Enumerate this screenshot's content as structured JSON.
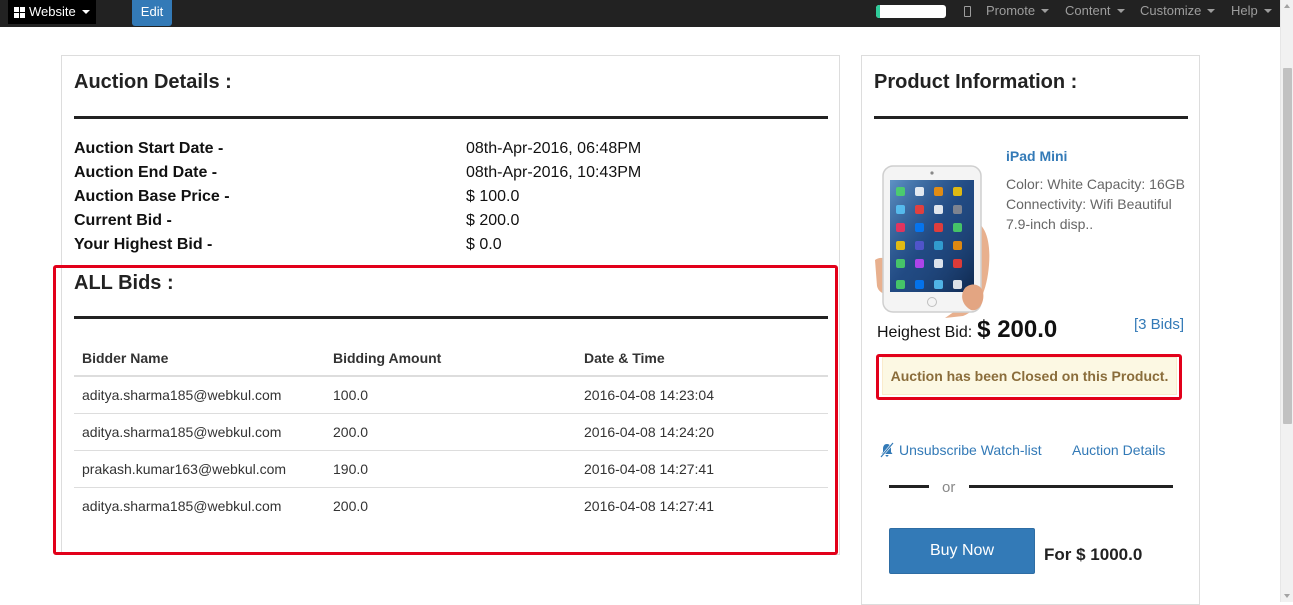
{
  "navbar": {
    "website_label": "Website",
    "edit_label": "Edit",
    "progress_fraction": 0.05,
    "menus": [
      {
        "label": "Promote"
      },
      {
        "label": "Content"
      },
      {
        "label": "Customize"
      },
      {
        "label": "Help"
      }
    ]
  },
  "auction_details": {
    "title": "Auction Details :",
    "rows": [
      {
        "label": "Auction Start Date -",
        "value": "08th-Apr-2016, 06:48PM"
      },
      {
        "label": "Auction End Date -",
        "value": "08th-Apr-2016, 10:43PM"
      },
      {
        "label": "Auction Base Price -",
        "value": "$ 100.0"
      },
      {
        "label": "Current Bid -",
        "value": "$ 200.0"
      },
      {
        "label": "Your Highest Bid -",
        "value": "$ 0.0"
      }
    ]
  },
  "all_bids": {
    "title": "ALL Bids :",
    "columns": [
      "Bidder Name",
      "Bidding Amount",
      "Date & Time"
    ],
    "rows": [
      [
        "aditya.sharma185@webkul.com",
        "100.0",
        "2016-04-08 14:23:04"
      ],
      [
        "aditya.sharma185@webkul.com",
        "200.0",
        "2016-04-08 14:24:20"
      ],
      [
        "prakash.kumar163@webkul.com",
        "190.0",
        "2016-04-08 14:27:41"
      ],
      [
        "aditya.sharma185@webkul.com",
        "200.0",
        "2016-04-08 14:27:41"
      ]
    ]
  },
  "product_info": {
    "title": "Product Information :",
    "name": "iPad Mini",
    "description": "Color: White Capacity: 16GB Connectivity: Wifi Beautiful 7.9-inch disp..",
    "highest_bid_label": "Heighest Bid:",
    "highest_bid_value": "$ 200.0",
    "bids_count": "[3 Bids]",
    "closed_message": "Auction has been Closed on this Product.",
    "unsubscribe_label": "Unsubscribe Watch-list",
    "auction_details_link": "Auction Details",
    "or_label": "or",
    "buy_now_label": "Buy Now",
    "buy_price": "For $ 1000.0"
  },
  "colors": {
    "accent": "#337ab7",
    "highlight_border": "#e2001a",
    "alert_text": "#8a6d3b",
    "alert_bg": "#fcf8e3"
  }
}
